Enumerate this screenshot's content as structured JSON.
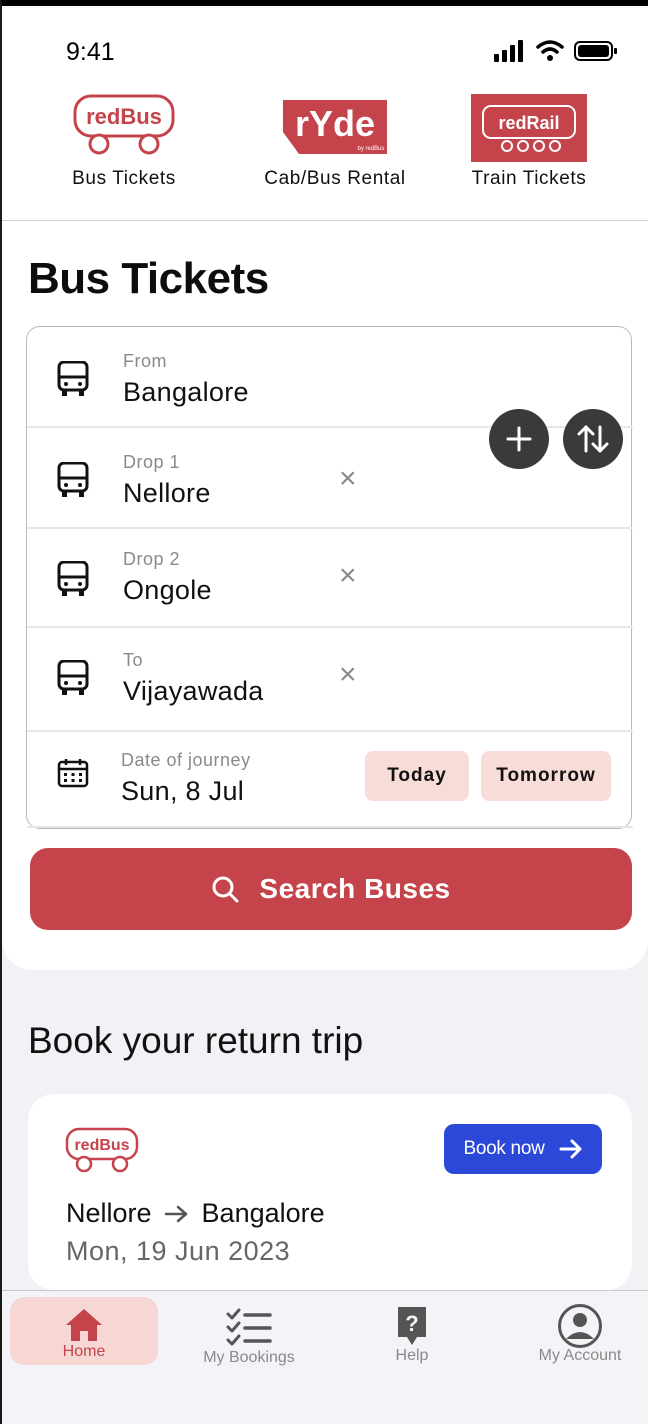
{
  "status_bar": {
    "time": "9:41"
  },
  "brands": [
    {
      "logo_text": "redBus",
      "label": "Bus Tickets"
    },
    {
      "logo_text": "rYde",
      "sub_text": "by redBus",
      "label": "Cab/Bus Rental"
    },
    {
      "logo_text": "redRail",
      "label": "Train Tickets"
    }
  ],
  "page_title": "Bus Tickets",
  "form": {
    "from": {
      "label": "From",
      "value": "Bangalore"
    },
    "drop1": {
      "label": "Drop 1",
      "value": "Nellore"
    },
    "drop2": {
      "label": "Drop 2",
      "value": "Ongole"
    },
    "to": {
      "label": "To",
      "value": "Vijayawada"
    },
    "date": {
      "label": "Date of journey",
      "value": "Sun, 8 Jul"
    },
    "today_label": "Today",
    "tomorrow_label": "Tomorrow",
    "clear_glyph": "×"
  },
  "search_button_label": "Search Buses",
  "return_trip": {
    "title": "Book your return trip",
    "logo_text": "redBus",
    "book_label": "Book now",
    "from": "Nellore",
    "to": "Bangalore",
    "date": "Mon, 19 Jun 2023"
  },
  "bottom_nav": [
    {
      "label": "Home",
      "icon": "home-icon",
      "active": true
    },
    {
      "label": "My Bookings",
      "icon": "checklist-icon",
      "active": false
    },
    {
      "label": "Help",
      "icon": "help-icon",
      "active": false
    },
    {
      "label": "My Account",
      "icon": "account-icon",
      "active": false
    }
  ],
  "colors": {
    "brand_red": "#c5434a",
    "chip_bg": "#f8dcd8",
    "book_blue": "#2b48d8",
    "fab_dark": "#3a3a3a"
  }
}
